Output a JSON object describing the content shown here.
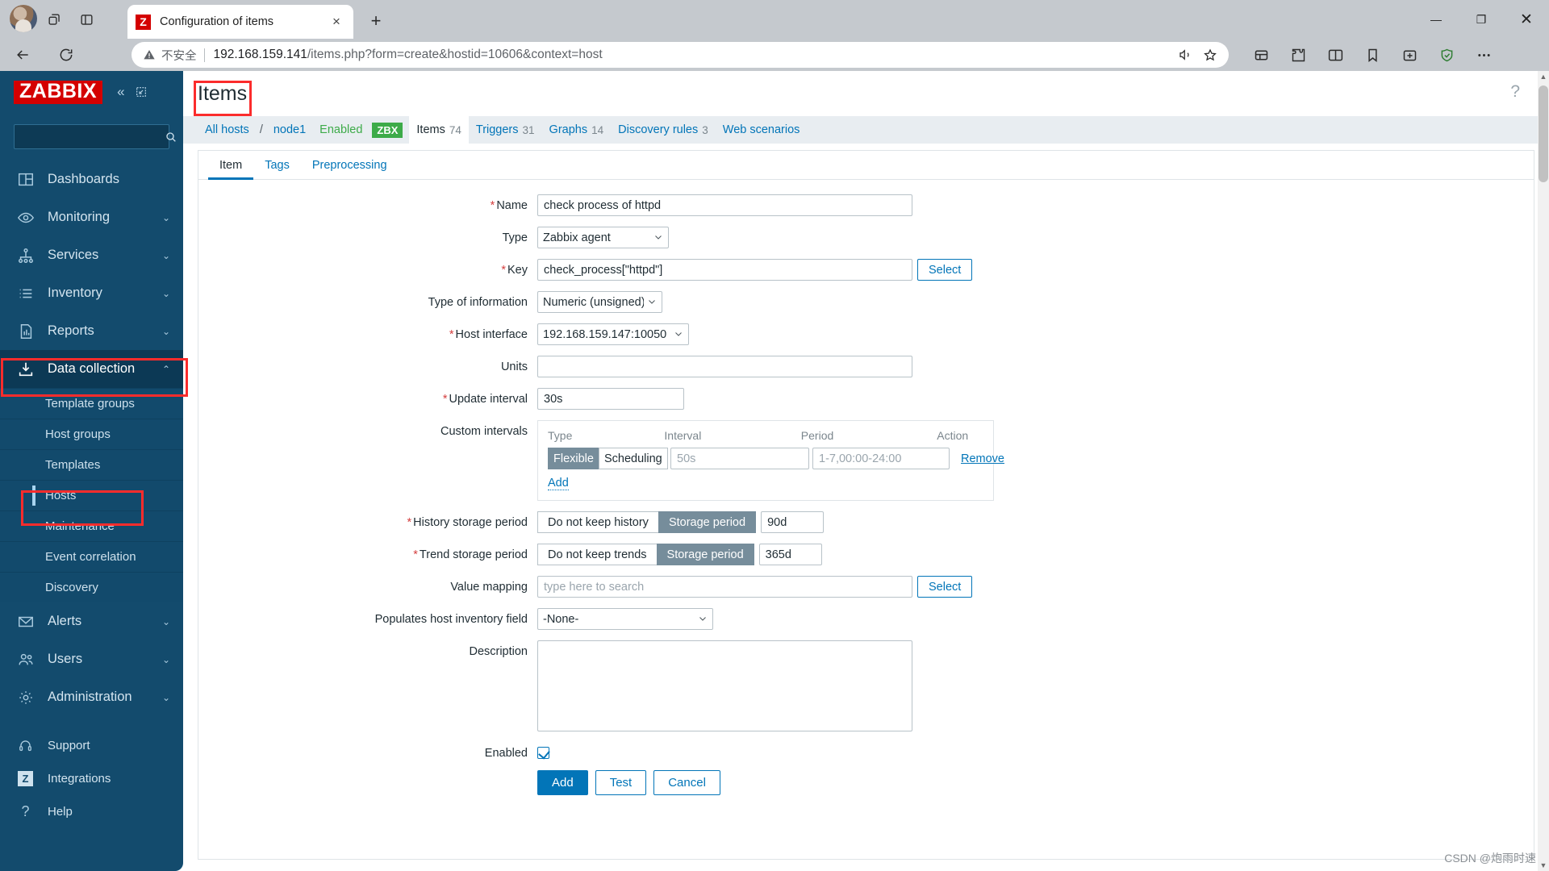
{
  "browser": {
    "tab": {
      "title": "Configuration of items",
      "favicon_letter": "Z",
      "favicon_color": "#d40000",
      "close_label": "×"
    },
    "new_tab_label": "+",
    "window_controls": {
      "minimize": "—",
      "maximize": "❐",
      "close": "✕"
    },
    "nav": {
      "back_icon": "back-arrow-icon",
      "reload_icon": "reload-icon"
    },
    "url": {
      "insecure_label": "不安全",
      "host": "192.168.159.141",
      "path": "/items.php?form=create&hostid=10606&context=host",
      "full": "192.168.159.141/items.php?form=create&hostid=10606&context=host"
    },
    "toolbar_icons": [
      "read-aloud-icon",
      "favorite-star-icon",
      "collections-icon",
      "extensions-puzzle-icon",
      "split-screen-icon",
      "favorites-ribbon-icon",
      "add-to-collection-icon",
      "browser-essentials-icon",
      "settings-more-icon"
    ]
  },
  "sidebar": {
    "logo": "ZABBIX",
    "collapse_icon": "«",
    "expand_icon": "expand-sidebar-icon",
    "search": {
      "value": "",
      "placeholder": ""
    },
    "items": [
      {
        "label": "Dashboards",
        "icon": "dashboard-grid-icon",
        "chevron": ""
      },
      {
        "label": "Monitoring",
        "icon": "eye-icon",
        "chevron": "⌄"
      },
      {
        "label": "Services",
        "icon": "services-tree-icon",
        "chevron": "⌄"
      },
      {
        "label": "Inventory",
        "icon": "list-icon",
        "chevron": "⌄"
      },
      {
        "label": "Reports",
        "icon": "bar-chart-report-icon",
        "chevron": "⌄"
      },
      {
        "label": "Data collection",
        "icon": "download-tray-icon",
        "chevron": "⌃",
        "selected": true
      },
      {
        "label": "Alerts",
        "icon": "envelope-icon",
        "chevron": "⌄"
      },
      {
        "label": "Users",
        "icon": "users-icon",
        "chevron": "⌄"
      },
      {
        "label": "Administration",
        "icon": "gear-icon",
        "chevron": "⌄"
      }
    ],
    "submenu": [
      {
        "label": "Template groups"
      },
      {
        "label": "Host groups"
      },
      {
        "label": "Templates"
      },
      {
        "label": "Hosts",
        "active": true
      },
      {
        "label": "Maintenance"
      },
      {
        "label": "Event correlation"
      },
      {
        "label": "Discovery"
      }
    ],
    "bottom_items": [
      {
        "label": "Support",
        "icon": "headset-icon"
      },
      {
        "label": "Integrations",
        "icon": "zabbix-z-badge-icon"
      },
      {
        "label": "Help",
        "icon": "question-mark-icon"
      }
    ]
  },
  "header": {
    "title": "Items",
    "help_icon": "?"
  },
  "breadcrumb": {
    "all_hosts": "All hosts",
    "separator": "/",
    "host": "node1",
    "status": "Enabled",
    "agent_badge": "ZBX",
    "entities": [
      {
        "label": "Items",
        "count": "74",
        "current": true
      },
      {
        "label": "Triggers",
        "count": "31"
      },
      {
        "label": "Graphs",
        "count": "14"
      },
      {
        "label": "Discovery rules",
        "count": "3"
      },
      {
        "label": "Web scenarios",
        "count": ""
      }
    ]
  },
  "tabs": [
    {
      "label": "Item",
      "active": true
    },
    {
      "label": "Tags",
      "active": false
    },
    {
      "label": "Preprocessing",
      "active": false
    }
  ],
  "form": {
    "name": {
      "label": "Name",
      "required": true,
      "value": "check process of httpd"
    },
    "type": {
      "label": "Type",
      "required": false,
      "value": "Zabbix agent"
    },
    "key": {
      "label": "Key",
      "required": true,
      "value": "check_process[\"httpd\"]",
      "select_button": "Select"
    },
    "type_of_information": {
      "label": "Type of information",
      "required": false,
      "value": "Numeric (unsigned)"
    },
    "host_interface": {
      "label": "Host interface",
      "required": true,
      "value": "192.168.159.147:10050"
    },
    "units": {
      "label": "Units",
      "required": false,
      "value": ""
    },
    "update_interval": {
      "label": "Update interval",
      "required": true,
      "value": "30s"
    },
    "custom_intervals": {
      "label": "Custom intervals",
      "columns": [
        "Type",
        "Interval",
        "Period",
        "Action"
      ],
      "rows": [
        {
          "type_options": [
            "Flexible",
            "Scheduling"
          ],
          "type_selected": "Flexible",
          "interval_value": "",
          "interval_placeholder": "50s",
          "period_value": "",
          "period_placeholder": "1-7,00:00-24:00",
          "action": "Remove"
        }
      ],
      "add_label": "Add"
    },
    "history_storage_period": {
      "label": "History storage period",
      "required": true,
      "options": [
        "Do not keep history",
        "Storage period"
      ],
      "selected": "Storage period",
      "value": "90d"
    },
    "trend_storage_period": {
      "label": "Trend storage period",
      "required": true,
      "options": [
        "Do not keep trends",
        "Storage period"
      ],
      "selected": "Storage period",
      "value": "365d"
    },
    "value_mapping": {
      "label": "Value mapping",
      "value": "",
      "placeholder": "type here to search",
      "select_button": "Select"
    },
    "populates_host_inventory_field": {
      "label": "Populates host inventory field",
      "value": "-None-"
    },
    "description": {
      "label": "Description",
      "value": ""
    },
    "enabled": {
      "label": "Enabled",
      "checked": true
    },
    "buttons": {
      "add": "Add",
      "test": "Test",
      "cancel": "Cancel"
    }
  },
  "annotations": {
    "color": "#fb2c2c",
    "targets": [
      "page-title-items",
      "sidebar-data-collection",
      "sidebar-hosts"
    ]
  },
  "watermark": "CSDN @炮雨时速"
}
